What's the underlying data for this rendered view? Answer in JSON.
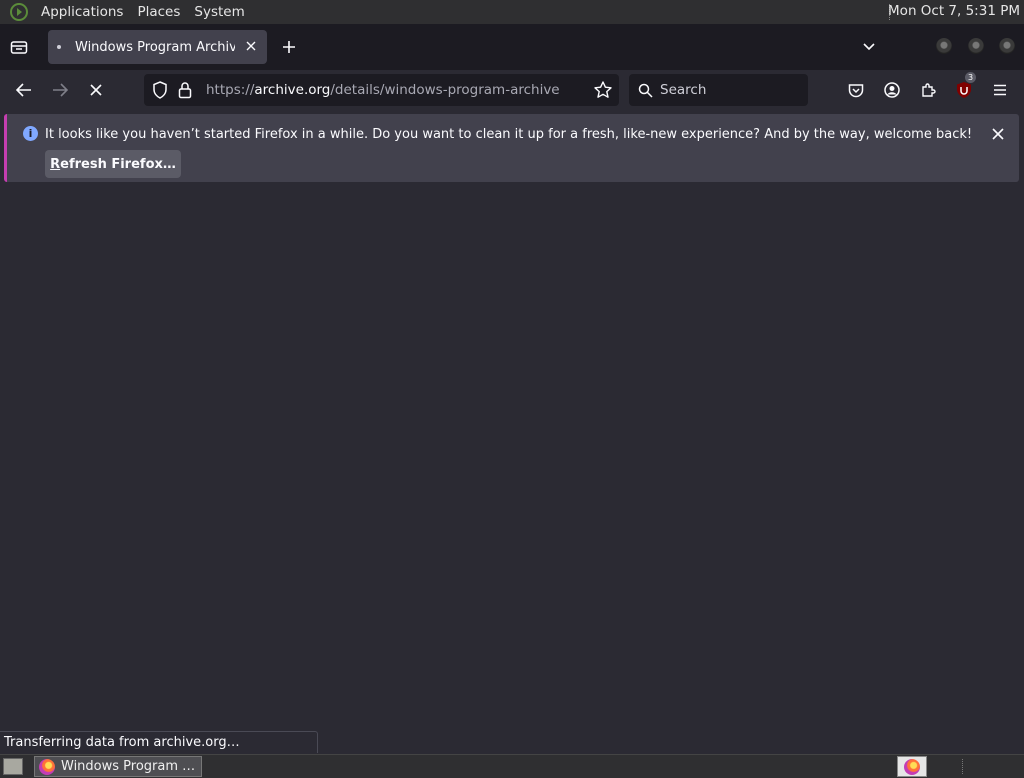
{
  "top_panel": {
    "menus": [
      "Applications",
      "Places",
      "System"
    ],
    "clock": "Mon Oct  7,  5:31 PM"
  },
  "tab": {
    "title": "Windows Program Archive"
  },
  "navbar": {
    "url_prefix": "https://",
    "url_host": "archive.org",
    "url_path": "/details/windows-program-archive",
    "search_placeholder": "Search",
    "extension_badge": "3"
  },
  "notification": {
    "message": "It looks like you haven’t started Firefox in a while. Do you want to clean it up for a fresh, like-new experience? And by the way, welcome back!",
    "button_first_letter": "R",
    "button_rest": "efresh Firefox…"
  },
  "status_text": "Transferring data from archive.org…",
  "taskbar": {
    "task_label": "Windows Program …"
  },
  "colors": {
    "chrome": "#1c1b22",
    "toolbar": "#2b2a33",
    "infobar": "#42414d",
    "accent": "#c53eb0"
  }
}
